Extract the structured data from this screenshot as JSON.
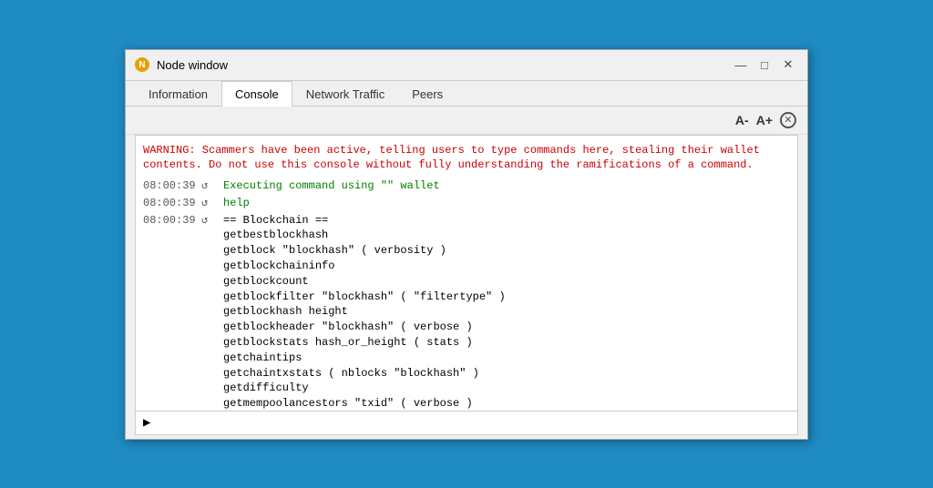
{
  "window": {
    "title": "Node window",
    "icon_label": "N"
  },
  "controls": {
    "minimize": "—",
    "maximize": "□",
    "close": "✕"
  },
  "tabs": [
    {
      "id": "information",
      "label": "Information",
      "active": false
    },
    {
      "id": "console",
      "label": "Console",
      "active": true
    },
    {
      "id": "network-traffic",
      "label": "Network Traffic",
      "active": false
    },
    {
      "id": "peers",
      "label": "Peers",
      "active": false
    }
  ],
  "toolbar": {
    "font_decrease": "A-",
    "font_increase": "A+",
    "close_label": "⊗"
  },
  "console": {
    "warning": "WARNING: Scammers have been active, telling users to type commands here, stealing\ntheir wallet contents. Do not use this console without fully understanding the\nramifications of a command.",
    "log_entries": [
      {
        "time": "08:00:39",
        "icon": "↺",
        "text": "Executing command using \"\" wallet",
        "color": "green"
      },
      {
        "time": "08:00:39",
        "icon": "↺",
        "text": "help",
        "color": "green"
      },
      {
        "time": "08:00:39",
        "icon": "↺",
        "text": "== Blockchain ==\ngetbestblockhash\ngetblock \"blockhash\" ( verbosity )\ngetblockchaininfo\ngetblockcount\ngetblockfilter \"blockhash\" ( \"filtertype\" )\ngetblockhash height\ngetblockheader \"blockhash\" ( verbose )\ngetblockstats hash_or_height ( stats )\ngetchaintips\ngetchaintxstats ( nblocks \"blockhash\" )\ngetdifficulty\ngetmempoolancestors \"txid\" ( verbose )\ngetmempooldescendants \"txid\" ( verbose )\ngetmempoolentry \"txid\"\ngetmempoolinfo",
        "color": "black"
      }
    ],
    "input_prompt": "▶",
    "input_placeholder": ""
  }
}
